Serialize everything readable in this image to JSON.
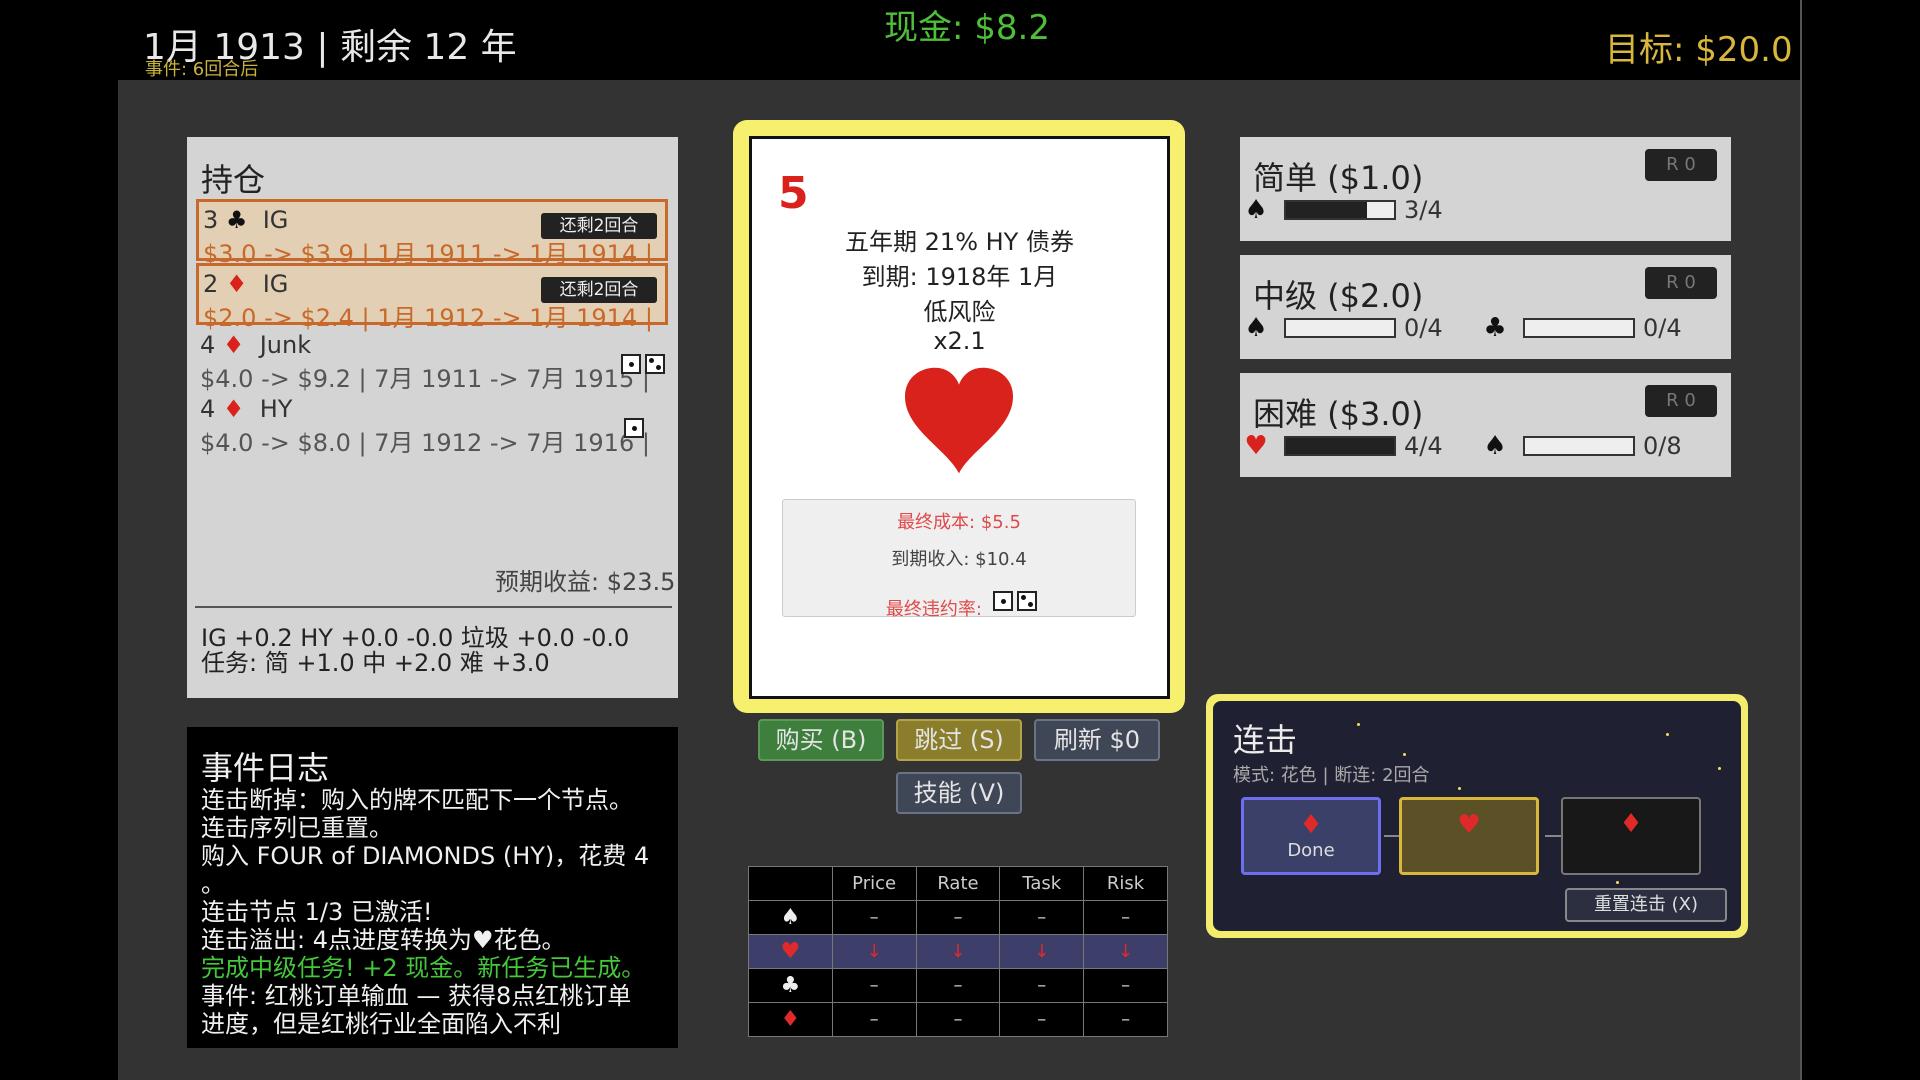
{
  "header": {
    "date": "1月 1913 | 剩余 12 年",
    "event_hint": "事件: 6回合后",
    "cash": "现金: $8.2",
    "goal": "目标: $20.0"
  },
  "holdings": {
    "title": "持仓",
    "items": [
      {
        "rank": "3",
        "suit": "♣",
        "type": "IG",
        "detail": "$3.0 -> $3.9 | 1月 1911 -> 1月 1914 |",
        "badge": "还剩2回合",
        "highlighted": true,
        "dice": 0
      },
      {
        "rank": "2",
        "suit": "♦",
        "type": "IG",
        "detail": "$2.0 -> $2.4 | 1月 1912 -> 1月 1914 |",
        "badge": "还剩2回合",
        "highlighted": true,
        "dice": 0
      },
      {
        "rank": "4",
        "suit": "♦",
        "type": "Junk",
        "detail": "$4.0 -> $9.2 | 7月 1911 -> 7月 1915 |",
        "badge": "",
        "highlighted": false,
        "dice": 2
      },
      {
        "rank": "4",
        "suit": "♦",
        "type": "HY",
        "detail": "$4.0 -> $8.0 | 7月 1912 -> 7月 1916 |",
        "badge": "",
        "highlighted": false,
        "dice": 1
      }
    ],
    "expected": "预期收益: $23.5",
    "modifiers_line1": "IG +0.2  HY +0.0 -0.0  垃圾 +0.0 -0.0",
    "modifiers_line2": "任务: 简 +1.0  中 +2.0  难 +3.0"
  },
  "event_log": {
    "title": "事件日志",
    "lines": [
      {
        "text": "连击断掉：购入的牌不匹配下一个节点。",
        "color": "white"
      },
      {
        "text": "连击序列已重置。",
        "color": "white"
      },
      {
        "text": "购入 FOUR of DIAMONDS (HY)，花费 4",
        "color": "white"
      },
      {
        "text": "。",
        "color": "white"
      },
      {
        "text": "连击节点 1/3 已激活!",
        "color": "white"
      },
      {
        "text": "连击溢出: 4点进度转换为♥花色。",
        "color": "white"
      },
      {
        "text": "完成中级任务! +2 现金。新任务已生成。",
        "color": "green"
      },
      {
        "text": "事件: 红桃订单输血 — 获得8点红桃订单",
        "color": "white"
      },
      {
        "text": "进度，但是红桃行业全面陷入不利",
        "color": "white"
      }
    ]
  },
  "card": {
    "rank": "5",
    "suit": "♥",
    "name": "五年期 21% HY 债券",
    "maturity": "到期: 1918年 1月",
    "risk": "低风险",
    "multiplier": "x2.1",
    "final_cost": "最终成本: $5.5",
    "maturity_income": "到期收入: $10.4",
    "default_rate_label": "最终违约率:",
    "default_dice": 2,
    "accent_color": "#d9221b",
    "frame_color": "#f7f06e"
  },
  "actions": {
    "buy": "购买 (B)",
    "skip": "跳过 (S)",
    "refresh": "刷新 $0",
    "skill": "技能 (V)"
  },
  "market": {
    "headers": [
      "",
      "Price",
      "Rate",
      "Task",
      "Risk"
    ],
    "rows": [
      {
        "suit": "♠",
        "values": [
          "–",
          "–",
          "–",
          "–"
        ],
        "highlighted": false
      },
      {
        "suit": "♥",
        "values": [
          "↓",
          "↓",
          "↓",
          "↓"
        ],
        "highlighted": true
      },
      {
        "suit": "♣",
        "values": [
          "–",
          "–",
          "–",
          "–"
        ],
        "highlighted": false
      },
      {
        "suit": "♦",
        "values": [
          "–",
          "–",
          "–",
          "–"
        ],
        "highlighted": false
      }
    ]
  },
  "tasks": [
    {
      "title": "简单 ($1.0)",
      "r": "R 0",
      "reqs": [
        {
          "suit": "♠",
          "progress": 0.75,
          "text": "3/4"
        }
      ]
    },
    {
      "title": "中级 ($2.0)",
      "r": "R 0",
      "reqs": [
        {
          "suit": "♠",
          "progress": 0,
          "text": "0/4"
        },
        {
          "suit": "♣",
          "progress": 0,
          "text": "0/4"
        }
      ]
    },
    {
      "title": "困难 ($3.0)",
      "r": "R 0",
      "reqs": [
        {
          "suit": "♥",
          "progress": 1.0,
          "text": "4/4"
        },
        {
          "suit": "♠",
          "progress": 0,
          "text": "0/8"
        }
      ]
    }
  ],
  "combo": {
    "title": "连击",
    "mode": "模式: 花色 | 断连: 2回合",
    "nodes": [
      {
        "suit": "♦",
        "label": "Done"
      },
      {
        "suit": "♥",
        "label": ""
      },
      {
        "suit": "♦",
        "label": ""
      }
    ],
    "reset": "重置连击 (X)"
  }
}
